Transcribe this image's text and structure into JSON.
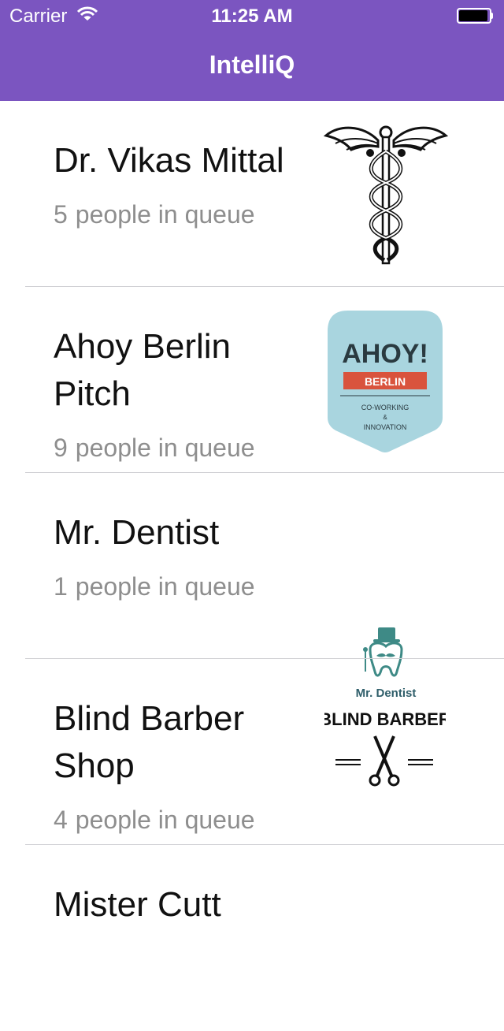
{
  "status_bar": {
    "carrier": "Carrier",
    "time": "11:25 AM"
  },
  "nav": {
    "title": "IntelliQ"
  },
  "queue_items": [
    {
      "name": "Dr. Vikas Mittal",
      "count": "5",
      "queue_label": "people in queue",
      "logo_icon": "caduceus-icon"
    },
    {
      "name": "Ahoy Berlin Pitch",
      "count": "9",
      "queue_label": "people in queue",
      "logo_icon": "ahoy-berlin-logo",
      "logo_text": {
        "title": "AHOY!",
        "ribbon": "BERLIN",
        "line1": "CO-WORKING",
        "line2": "&",
        "line3": "INNOVATION"
      }
    },
    {
      "name": "Mr. Dentist",
      "count": "1",
      "queue_label": "people in queue",
      "logo_icon": "mr-dentist-logo",
      "logo_text": {
        "title": "Mr. Dentist"
      }
    },
    {
      "name": "Blind Barber Shop",
      "count": "4",
      "queue_label": "people in queue",
      "logo_icon": "blind-barber-logo",
      "logo_text": {
        "title": "BLIND BARBER"
      }
    },
    {
      "name": "Mister Cutt"
    }
  ],
  "colors": {
    "accent": "#7b55c0",
    "ahoy_teal": "#a9d5df",
    "ahoy_red": "#d9533d",
    "dentist_teal": "#3e8a86"
  }
}
